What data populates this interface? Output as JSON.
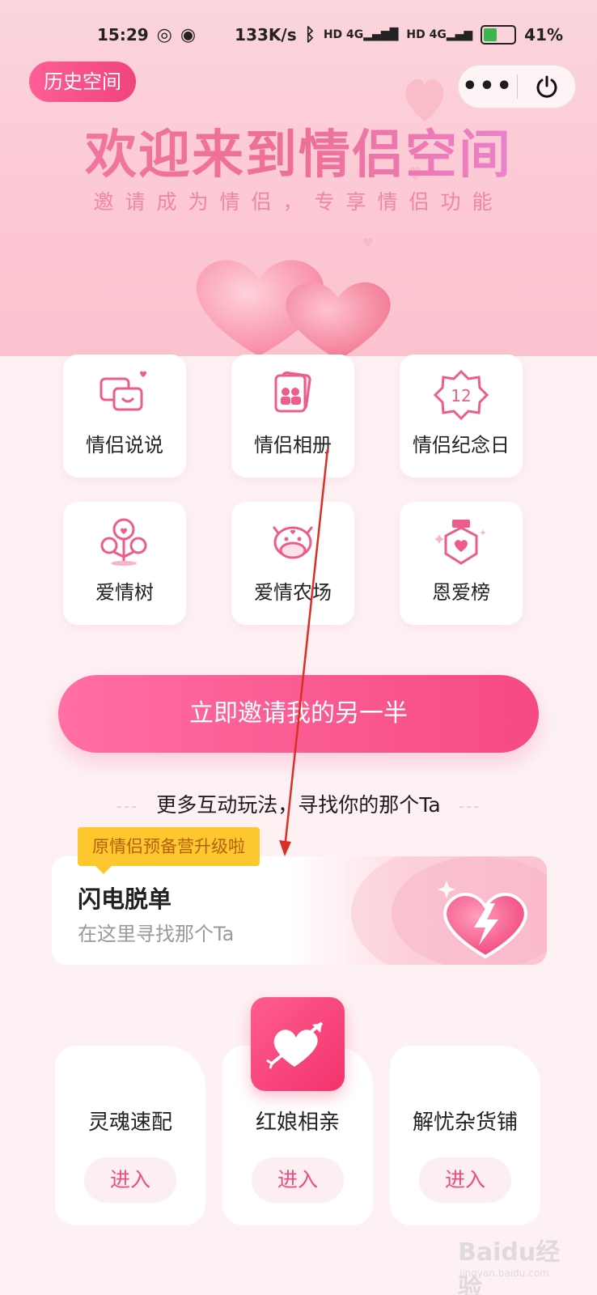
{
  "status_bar": {
    "time": "15:29",
    "speed": "133K/s",
    "network1": "4G",
    "network2": "4G",
    "battery": "41%"
  },
  "header": {
    "history_button": "历史空间",
    "more_label": "•••",
    "title": "欢迎来到情侣空间",
    "subtitle": "邀请成为情侣，专享情侣功能"
  },
  "features": [
    {
      "label": "情侣说说",
      "icon": "chat-bubbles-icon"
    },
    {
      "label": "情侣相册",
      "icon": "photo-album-icon"
    },
    {
      "label": "情侣纪念日",
      "icon": "calendar-badge-icon"
    },
    {
      "label": "爱情树",
      "icon": "love-tree-icon"
    },
    {
      "label": "爱情农场",
      "icon": "cow-icon"
    },
    {
      "label": "恩爱榜",
      "icon": "ranking-medal-icon"
    }
  ],
  "invite_button": "立即邀请我的另一半",
  "more_play": {
    "dash": "---",
    "text": "更多互动玩法，寻找你的那个Ta"
  },
  "flash": {
    "badge": "原情侣预备营升级啦",
    "title": "闪电脱单",
    "subtitle": "在这里寻找那个Ta"
  },
  "bottom_cards": [
    {
      "label": "灵魂速配",
      "enter": "进入"
    },
    {
      "label": "红娘相亲",
      "enter": "进入"
    },
    {
      "label": "解忧杂货铺",
      "enter": "进入"
    }
  ],
  "watermark": {
    "main": "Baidu经验",
    "sub": "jingyan.baidu.com"
  },
  "colors": {
    "accent": "#f64a82",
    "header_bg": "#fcc8d3",
    "badge_bg": "#fdc82f",
    "annotation": "#d93025"
  }
}
